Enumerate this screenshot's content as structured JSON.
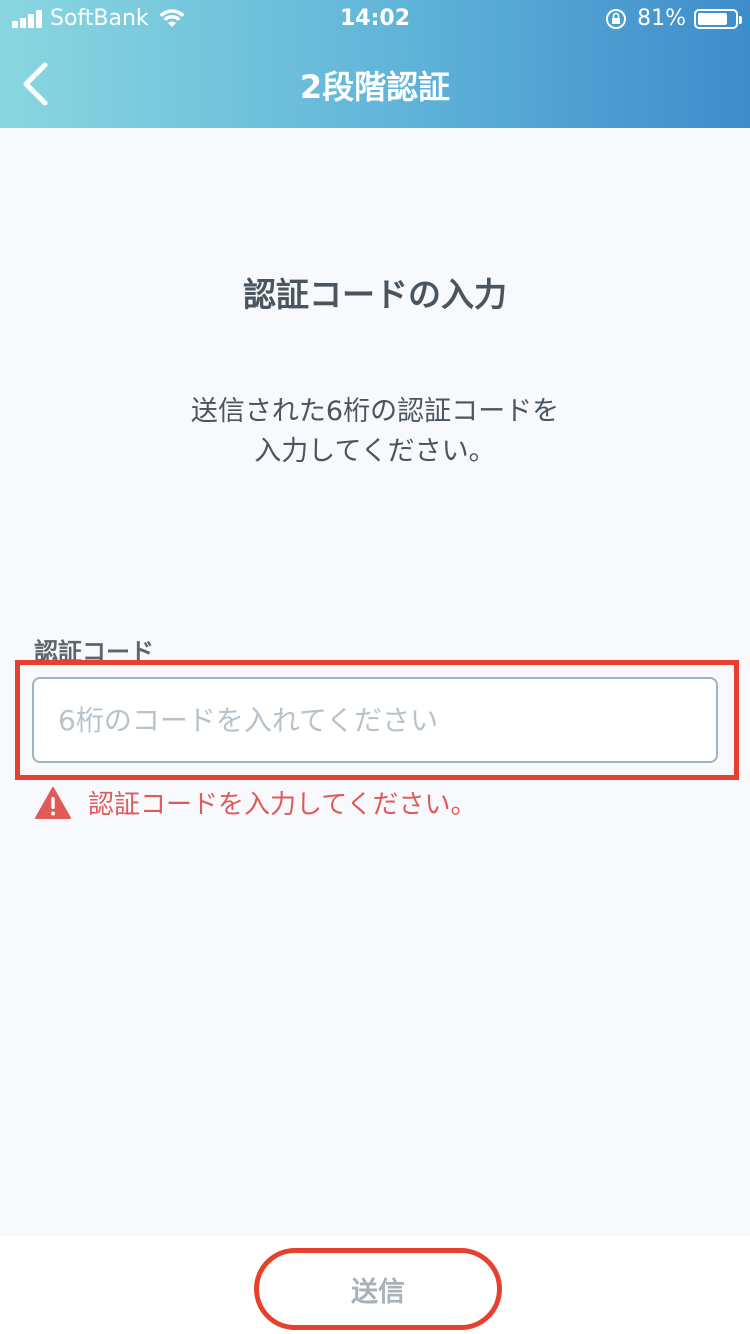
{
  "status_bar": {
    "carrier": "SoftBank",
    "time": "14:02",
    "battery_percent": "81%",
    "battery_level": 0.81
  },
  "nav": {
    "title": "2段階認証",
    "back_icon": "chevron-left-icon"
  },
  "main": {
    "heading": "認証コードの入力",
    "description_line1": "送信された6桁の認証コードを",
    "description_line2": "入力してください。",
    "field_label": "認証コード",
    "input_value": "",
    "input_placeholder": "6桁のコードを入れてください",
    "error_icon": "warning-icon",
    "error_message": "認証コードを入力してください。"
  },
  "footer": {
    "submit_label": "送信"
  },
  "colors": {
    "header_gradient_start": "#8ad7e0",
    "header_gradient_end": "#3f8ccc",
    "highlight": "#e8402e",
    "error": "#e05a58",
    "text_dark": "#4a5560"
  }
}
